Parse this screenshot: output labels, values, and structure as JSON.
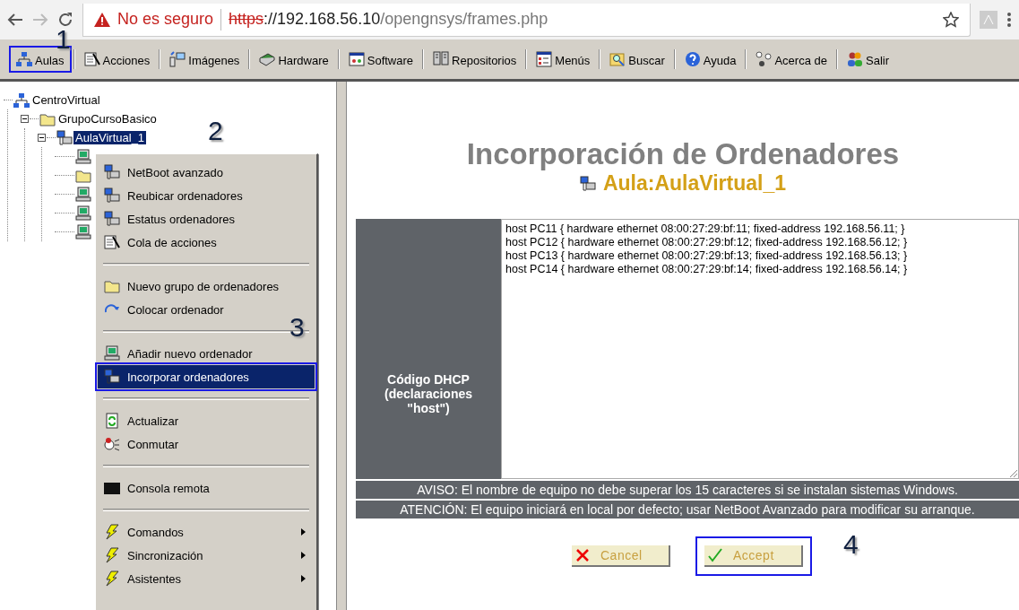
{
  "browser": {
    "security": "No es seguro",
    "url_scheme": "https",
    "url_host": "://192.168.56.10",
    "url_path": "/opengnsys/frames.php"
  },
  "toolbar": [
    {
      "label": "Aulas",
      "kind": "network",
      "callout": "1"
    },
    {
      "label": "Acciones",
      "kind": "actions"
    },
    {
      "label": "Imágenes",
      "kind": "images"
    },
    {
      "label": "Hardware",
      "kind": "hardware"
    },
    {
      "label": "Software",
      "kind": "software"
    },
    {
      "label": "Repositorios",
      "kind": "repos"
    },
    {
      "label": "Menús",
      "kind": "menus"
    },
    {
      "label": "Buscar",
      "kind": "search"
    },
    {
      "label": "Ayuda",
      "kind": "help"
    },
    {
      "label": "Acerca de",
      "kind": "about"
    },
    {
      "label": "Salir",
      "kind": "users"
    }
  ],
  "tree": [
    {
      "label": "CentroVirtual",
      "kind": "network",
      "selected": false,
      "children": [
        {
          "label": "GrupoCursoBasico",
          "kind": "folder",
          "expanded": true,
          "selected": false,
          "children": [
            {
              "label": "AulaVirtual_1",
              "kind": "classroom",
              "expanded": true,
              "selected": true,
              "callout": "2",
              "children": [
                {
                  "kind": "computer"
                },
                {
                  "kind": "folder"
                },
                {
                  "kind": "computer"
                },
                {
                  "kind": "computer"
                },
                {
                  "kind": "computer"
                }
              ]
            }
          ]
        }
      ]
    }
  ],
  "context_menu": {
    "groups": [
      [
        {
          "label": "NetBoot avanzado",
          "kind": "computers",
          "selected": false
        },
        {
          "label": "Reubicar ordenadores",
          "kind": "computers",
          "selected": false
        },
        {
          "label": "Estatus ordenadores",
          "kind": "computers",
          "selected": false
        },
        {
          "label": "Cola de acciones",
          "kind": "actions",
          "selected": false
        }
      ],
      [
        {
          "label": "Nuevo grupo de ordenadores",
          "kind": "folder",
          "selected": false
        },
        {
          "label": "Colocar ordenador",
          "kind": "move",
          "selected": false
        }
      ],
      [
        {
          "label": "Añadir nuevo ordenador",
          "kind": "computer",
          "selected": false,
          "callout": "3"
        },
        {
          "label": "Incorporar ordenadores",
          "kind": "classroom",
          "selected": true
        }
      ],
      [
        {
          "label": "Actualizar",
          "kind": "refresh",
          "selected": false
        },
        {
          "label": "Conmutar",
          "kind": "switch",
          "selected": false
        }
      ],
      [
        {
          "label": "Consola remota",
          "kind": "console",
          "selected": false
        }
      ],
      [
        {
          "label": "Comandos",
          "kind": "bolt",
          "selected": false,
          "submenu": true
        },
        {
          "label": "Sincronización",
          "kind": "bolt",
          "selected": false,
          "submenu": true
        },
        {
          "label": "Asistentes",
          "kind": "bolt",
          "selected": false,
          "submenu": true
        }
      ]
    ]
  },
  "page": {
    "title": "Incorporación de Ordenadores",
    "subtitle": "Aula:AulaVirtual_1",
    "form": {
      "label_lines": [
        "Código DHCP",
        "(declaraciones",
        "\"host\")"
      ],
      "value_lines": [
        "host PC11 { hardware ethernet 08:00:27:29:bf:11; fixed-address 192.168.56.11; }",
        "host PC12 { hardware ethernet 08:00:27:29:bf:12; fixed-address 192.168.56.12; }",
        "host PC13 { hardware ethernet 08:00:27:29:bf:13; fixed-address 192.168.56.13; }",
        "host PC14 { hardware ethernet 08:00:27:29:bf:14; fixed-address 192.168.56.14; }"
      ]
    },
    "notices": [
      "AVISO: El nombre de equipo no debe superar los 15 caracteres si se instalan sistemas Windows.",
      "ATENCIÓN: El equipo iniciará en local por defecto; usar NetBoot Avanzado para modificar su arranque."
    ],
    "buttons": [
      {
        "label": "Cancel",
        "kind": "cancel"
      },
      {
        "label": "Accept",
        "kind": "accept",
        "callout": "4"
      }
    ]
  }
}
